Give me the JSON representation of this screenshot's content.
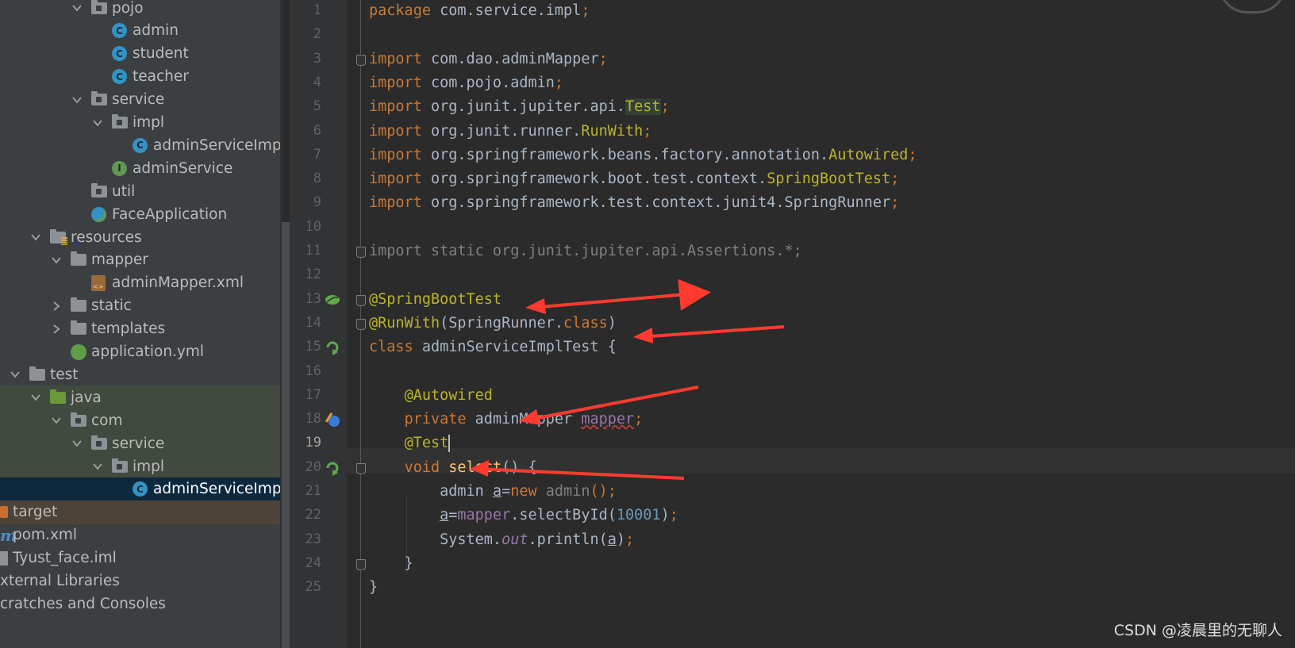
{
  "project_tree": [
    {
      "label": "pojo",
      "indent": 3,
      "arrow": "down",
      "icon": "folder-pkg"
    },
    {
      "label": "admin",
      "indent": 4,
      "icon": "class",
      "icon_letter": "C"
    },
    {
      "label": "student",
      "indent": 4,
      "icon": "class",
      "icon_letter": "C"
    },
    {
      "label": "teacher",
      "indent": 4,
      "icon": "class",
      "icon_letter": "C"
    },
    {
      "label": "service",
      "indent": 3,
      "arrow": "down",
      "icon": "folder-pkg"
    },
    {
      "label": "impl",
      "indent": 4,
      "arrow": "down",
      "icon": "folder-pkg"
    },
    {
      "label": "adminServiceImpl",
      "indent": 5,
      "icon": "class",
      "icon_letter": "C"
    },
    {
      "label": "adminService",
      "indent": 4,
      "icon": "interface",
      "icon_letter": "I"
    },
    {
      "label": "util",
      "indent": 3,
      "icon": "folder-pkg"
    },
    {
      "label": "FaceApplication",
      "indent": 3,
      "icon": "spring-class"
    },
    {
      "label": "resources",
      "indent": 1,
      "arrow": "down",
      "icon": "folder-res"
    },
    {
      "label": "mapper",
      "indent": 2,
      "arrow": "down",
      "icon": "folder"
    },
    {
      "label": "adminMapper.xml",
      "indent": 3,
      "icon": "xml"
    },
    {
      "label": "static",
      "indent": 2,
      "arrow": "right",
      "icon": "folder"
    },
    {
      "label": "templates",
      "indent": 2,
      "arrow": "right",
      "icon": "folder"
    },
    {
      "label": "application.yml",
      "indent": 2,
      "icon": "yml"
    },
    {
      "label": "test",
      "indent": 0,
      "arrow": "down",
      "icon": "folder"
    },
    {
      "label": "java",
      "indent": 1,
      "arrow": "down",
      "icon": "folder-src",
      "highlight": "green"
    },
    {
      "label": "com",
      "indent": 2,
      "arrow": "down",
      "icon": "folder-pkg",
      "highlight": "green"
    },
    {
      "label": "service",
      "indent": 3,
      "arrow": "down",
      "icon": "folder-pkg",
      "highlight": "green"
    },
    {
      "label": "impl",
      "indent": 4,
      "arrow": "down",
      "icon": "folder-pkg",
      "highlight": "green"
    },
    {
      "label": "adminServiceImplTest",
      "indent": 5,
      "icon": "class",
      "icon_letter": "C",
      "highlight": "selected"
    },
    {
      "label": "target",
      "indent": 0,
      "icon": "folder-target",
      "highlight": "orange"
    },
    {
      "label": "pom.xml",
      "indent": 0,
      "icon": "maven"
    },
    {
      "label": "Tyust_face.iml",
      "indent": 0,
      "icon": "iml"
    },
    {
      "label": "xternal Libraries",
      "indent": -1,
      "icon": "none"
    },
    {
      "label": "cratches and Consoles",
      "indent": -1,
      "icon": "none"
    }
  ],
  "editor": {
    "current_line": 19,
    "lines": [
      {
        "n": "1",
        "t": [
          [
            "kw",
            "package "
          ],
          [
            "",
            "com.service.impl"
          ],
          [
            "kw",
            ";"
          ]
        ]
      },
      {
        "n": "2",
        "t": []
      },
      {
        "n": "3",
        "t": [
          [
            "kw",
            "import "
          ],
          [
            "",
            "com.dao.adminMapper"
          ],
          [
            "kw",
            ";"
          ]
        ],
        "fold": true
      },
      {
        "n": "4",
        "t": [
          [
            "kw",
            "import "
          ],
          [
            "",
            "com.pojo.admin"
          ],
          [
            "kw",
            ";"
          ]
        ]
      },
      {
        "n": "5",
        "t": [
          [
            "kw",
            "import "
          ],
          [
            "",
            "org.junit.jupiter.api."
          ],
          [
            "ann hl-test",
            "Test"
          ],
          [
            "kw",
            ";"
          ]
        ]
      },
      {
        "n": "6",
        "t": [
          [
            "kw",
            "import "
          ],
          [
            "",
            "org.junit.runner."
          ],
          [
            "ann",
            "RunWith"
          ],
          [
            "kw",
            ";"
          ]
        ]
      },
      {
        "n": "7",
        "t": [
          [
            "kw",
            "import "
          ],
          [
            "",
            "org.springframework.beans.factory.annotation."
          ],
          [
            "ann",
            "Autowired"
          ],
          [
            "kw",
            ";"
          ]
        ]
      },
      {
        "n": "8",
        "t": [
          [
            "kw",
            "import "
          ],
          [
            "",
            "org.springframework.boot.test.context."
          ],
          [
            "ann",
            "SpringBootTest"
          ],
          [
            "kw",
            ";"
          ]
        ]
      },
      {
        "n": "9",
        "t": [
          [
            "kw",
            "import "
          ],
          [
            "",
            "org.springframework.test.context.junit4.SpringRunner"
          ],
          [
            "kw",
            ";"
          ]
        ]
      },
      {
        "n": "10",
        "t": []
      },
      {
        "n": "11",
        "t": [
          [
            "gray",
            "import static org.junit.jupiter.api.Assertions.*;"
          ]
        ],
        "fold": true
      },
      {
        "n": "12",
        "t": []
      },
      {
        "n": "13",
        "t": [
          [
            "ann",
            "@SpringBootTest"
          ]
        ],
        "fold": true,
        "gutter": "spring-bean-icon"
      },
      {
        "n": "14",
        "t": [
          [
            "ann",
            "@RunWith"
          ],
          [
            "",
            "(SpringRunner."
          ],
          [
            "kw",
            "class"
          ],
          [
            "",
            ")"
          ]
        ],
        "fold": true
      },
      {
        "n": "15",
        "t": [
          [
            "kw",
            "class "
          ],
          [
            "",
            "adminServiceImplTest {"
          ]
        ],
        "gutter": "run-icon"
      },
      {
        "n": "16",
        "t": []
      },
      {
        "n": "17",
        "t": [
          [
            "",
            "    "
          ],
          [
            "ann",
            "@Autowired"
          ]
        ]
      },
      {
        "n": "18",
        "t": [
          [
            "",
            "    "
          ],
          [
            "kw",
            "private "
          ],
          [
            "",
            "adminMapper "
          ],
          [
            "fld squig",
            "mapper"
          ],
          [
            "kw",
            ";"
          ]
        ],
        "gutter": "autowired-icon"
      },
      {
        "n": "19",
        "t": [
          [
            "",
            "    "
          ],
          [
            "ann",
            "@Test"
          ],
          [
            "caret",
            ""
          ]
        ]
      },
      {
        "n": "20",
        "t": [
          [
            "",
            "    "
          ],
          [
            "kw",
            "void "
          ],
          [
            "fn",
            "select"
          ],
          [
            "",
            "() {"
          ]
        ],
        "fold": true,
        "gutter": "run-icon"
      },
      {
        "n": "21",
        "t": [
          [
            "",
            "        admin "
          ],
          [
            "uline",
            "a"
          ],
          [
            "",
            "="
          ],
          [
            "kw",
            "new "
          ],
          [
            "gray",
            "admin"
          ],
          [
            "kw",
            "();"
          ]
        ]
      },
      {
        "n": "22",
        "t": [
          [
            "",
            "        "
          ],
          [
            "uline",
            "a"
          ],
          [
            "",
            "="
          ],
          [
            "fld",
            "mapper"
          ],
          [
            "",
            ".selectById("
          ],
          [
            "num",
            "10001"
          ],
          [
            "",
            ")"
          ],
          [
            "kw",
            ";"
          ]
        ]
      },
      {
        "n": "23",
        "t": [
          [
            "",
            "        System."
          ],
          [
            "fld italic",
            "out"
          ],
          [
            "",
            ".println("
          ],
          [
            "uline",
            "a"
          ],
          [
            "",
            ")"
          ],
          [
            "kw",
            ";"
          ]
        ]
      },
      {
        "n": "24",
        "t": [
          [
            "",
            "    }"
          ]
        ],
        "fold": true
      },
      {
        "n": "25",
        "t": [
          [
            "",
            "}"
          ]
        ]
      }
    ]
  },
  "watermark": "CSDN @凌晨里的无聊人",
  "colors": {
    "arrow": "#ff3b30",
    "keyword": "#cc7832",
    "annotation": "#bbb529"
  }
}
